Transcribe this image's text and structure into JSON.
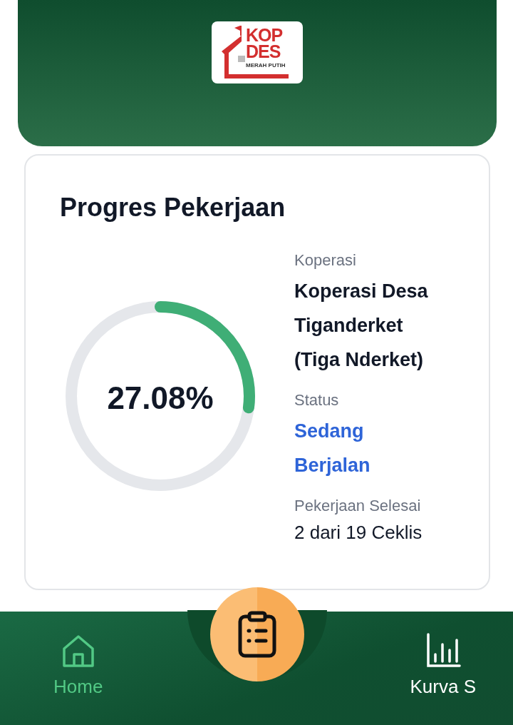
{
  "header": {
    "logo": {
      "line_1": "KOP",
      "line_2": "DES",
      "tagline": "MERAH PUTIH"
    }
  },
  "progress_card": {
    "title": "Progres Pekerjaan",
    "percent": "27.08%",
    "level": 0.2708,
    "fields": [
      {
        "label": "Koperasi",
        "value": "Koperasi Desa Tiganderket (Tiga Nderket)",
        "kind": "name"
      },
      {
        "label": "Status",
        "value": "Sedang Berjalan",
        "kind": "status"
      },
      {
        "label": "Pekerjaan Selesai",
        "value": "2 dari 19 Ceklis",
        "kind": "plain"
      }
    ]
  },
  "bottom_nav": {
    "items": [
      {
        "label": "Home",
        "kind": "home",
        "selected": true
      },
      {
        "label": "Kurva S",
        "kind": "chart",
        "selected": false
      }
    ]
  }
}
